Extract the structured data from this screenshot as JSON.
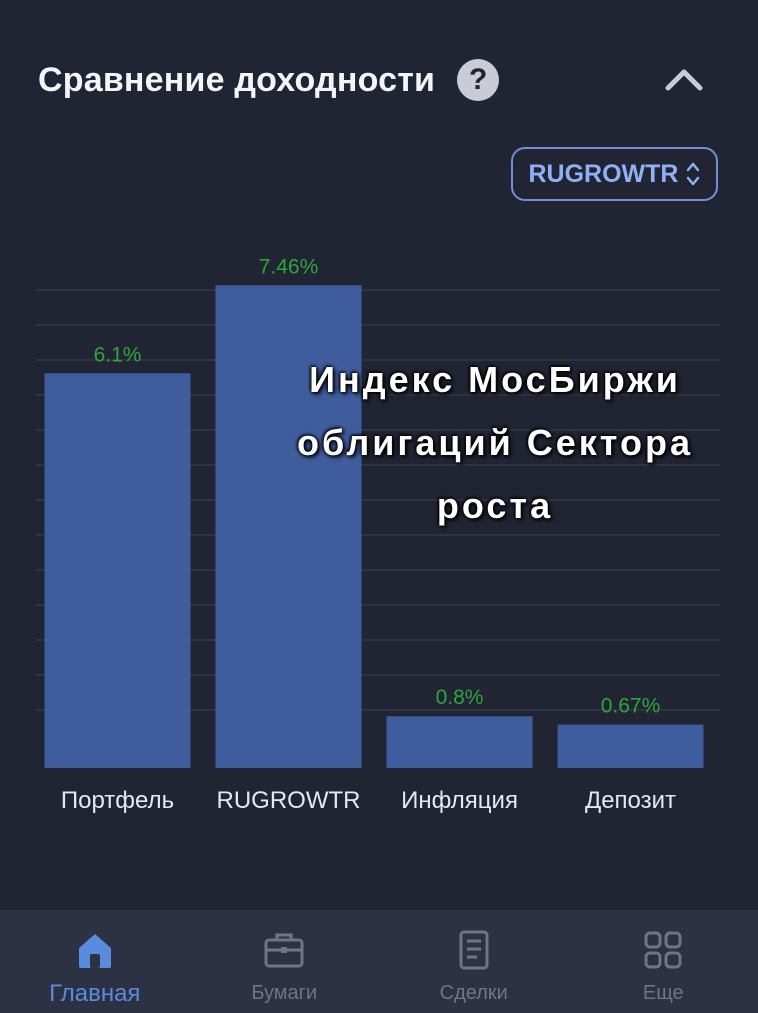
{
  "header": {
    "title": "Сравнение доходности",
    "help_icon": "question-circle-icon",
    "collapse_icon": "chevron-up-icon"
  },
  "selector": {
    "value": "RUGROWTR"
  },
  "overlay_caption": {
    "line1": "Индекс МосБиржи",
    "line2": "облигаций Сектора",
    "line3": "роста"
  },
  "colors": {
    "background": "#212533",
    "bar": "#3f5c9c",
    "value_label": "#2fa33c",
    "accent": "#5b8bdc"
  },
  "chart_data": {
    "type": "bar",
    "categories": [
      "Портфель",
      "RUGROWTR",
      "Инфляция",
      "Депозит"
    ],
    "values": [
      6.1,
      7.46,
      0.8,
      0.67
    ],
    "value_labels": [
      "6.1%",
      "7.46%",
      "0.8%",
      "0.67%"
    ],
    "ylim": [
      0,
      8.5
    ],
    "grid": true
  },
  "tabbar": {
    "tabs": [
      {
        "label": "Главная",
        "icon": "home-icon",
        "active": true
      },
      {
        "label": "Бумаги",
        "icon": "briefcase-icon",
        "active": false
      },
      {
        "label": "Сделки",
        "icon": "document-icon",
        "active": false
      },
      {
        "label": "Еще",
        "icon": "grid-icon",
        "active": false
      }
    ]
  }
}
